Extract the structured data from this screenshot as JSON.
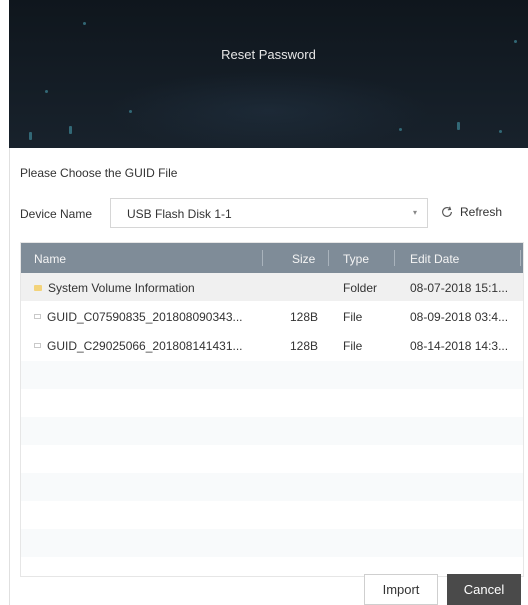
{
  "dialog": {
    "title": "Reset Password"
  },
  "section": {
    "label": "Please Choose the GUID File"
  },
  "device": {
    "label": "Device Name",
    "selected": "USB Flash Disk 1-1",
    "refresh_label": "Refresh"
  },
  "table": {
    "columns": [
      "Name",
      "Size",
      "Type",
      "Edit Date"
    ],
    "rows": [
      {
        "icon": "folder-icon",
        "name": "System Volume Information",
        "size": "",
        "type": "Folder",
        "date": "08-07-2018 15:1..."
      },
      {
        "icon": "file-icon",
        "name": "GUID_C07590835_201808090343...",
        "size": "128B",
        "type": "File",
        "date": "08-09-2018 03:4..."
      },
      {
        "icon": "file-icon",
        "name": "GUID_C29025066_201808141431...",
        "size": "128B",
        "type": "File",
        "date": "08-14-2018 14:3..."
      }
    ]
  },
  "buttons": {
    "import": "Import",
    "cancel": "Cancel"
  },
  "colors": {
    "header_bg": "#121a22",
    "table_header_bg": "#7f8c98",
    "cancel_bg": "#4a4a4a",
    "folder": "#f3d37a"
  }
}
